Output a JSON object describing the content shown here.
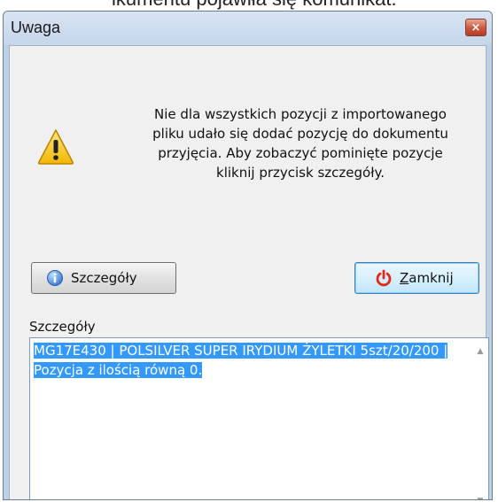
{
  "background_caption_fragment": "ikumentu pojawiła się komunikat.",
  "dialog": {
    "title": "Uwaga",
    "close_glyph": "×",
    "message": "Nie dla wszystkich pozycji z importowanego\npliku udało się dodać pozycję do dokumentu\nprzyjęcia. Aby zobaczyć pominięte pozycje\nkliknij przycisk szczegóły.",
    "buttons": {
      "details_label": "Szczegóły",
      "close_label_underlined": "Z",
      "close_label_rest": "amknij"
    },
    "details": {
      "label": "Szczegóły",
      "text": "MG17E430  |  POLSILVER SUPER IRYDIUM ŻYLETKI 5szt/20/200 | Pozycja z ilością równą 0."
    },
    "scrollbar": {
      "up_glyph": "▲",
      "down_glyph": "▼"
    }
  },
  "colors": {
    "selection": "#3399ff",
    "power_icon": "#e0281c",
    "info_icon": "#3a7bd5",
    "warning_icon": "#f5c518"
  },
  "icons": [
    "warning-icon",
    "info-icon",
    "power-icon",
    "close-icon"
  ]
}
